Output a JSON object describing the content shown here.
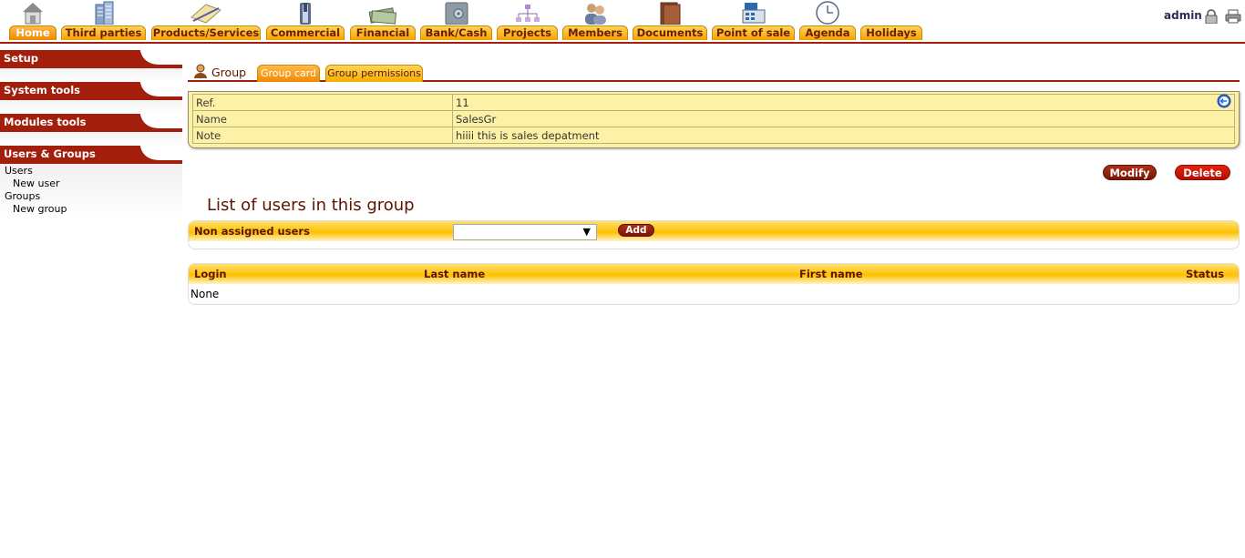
{
  "topmenu": {
    "items": [
      {
        "label": "Home",
        "icon": "home-icon"
      },
      {
        "label": "Third parties",
        "icon": "buildings-icon"
      },
      {
        "label": "Products/Services",
        "icon": "products-icon"
      },
      {
        "label": "Commercial",
        "icon": "commercial-icon"
      },
      {
        "label": "Financial",
        "icon": "money-icon"
      },
      {
        "label": "Bank/Cash",
        "icon": "safe-icon"
      },
      {
        "label": "Projects",
        "icon": "project-tree-icon"
      },
      {
        "label": "Members",
        "icon": "members-icon"
      },
      {
        "label": "Documents",
        "icon": "documents-icon"
      },
      {
        "label": "Point of sale",
        "icon": "cash-register-icon"
      },
      {
        "label": "Agenda",
        "icon": "clock-icon"
      },
      {
        "label": "Holidays",
        "icon": ""
      }
    ],
    "login": "admin"
  },
  "leftmenu": {
    "setup": "Setup",
    "system_tools": "System tools",
    "modules_tools": "Modules tools",
    "users_groups": "Users & Groups",
    "users": "Users",
    "new_user": "New user",
    "groups": "Groups",
    "new_group": "New group"
  },
  "tabs": {
    "title": "Group",
    "group_card": "Group card",
    "group_permissions": "Group permissions"
  },
  "card": {
    "ref_label": "Ref.",
    "ref_value": "11",
    "name_label": "Name",
    "name_value": "SalesGr",
    "note_label": "Note",
    "note_value": "hiiii this is sales depatment"
  },
  "actions": {
    "modify": "Modify",
    "delete": "Delete"
  },
  "list": {
    "title": "List of users in this group",
    "non_assigned": "Non assigned users",
    "select_value": "",
    "add": "Add",
    "columns": {
      "login": "Login",
      "last_name": "Last name",
      "first_name": "First name",
      "status": "Status"
    },
    "empty": "None"
  },
  "colors": {
    "accent": "#a31f0c",
    "tab": "#f5b000",
    "card_bg": "#fdf1a6"
  }
}
